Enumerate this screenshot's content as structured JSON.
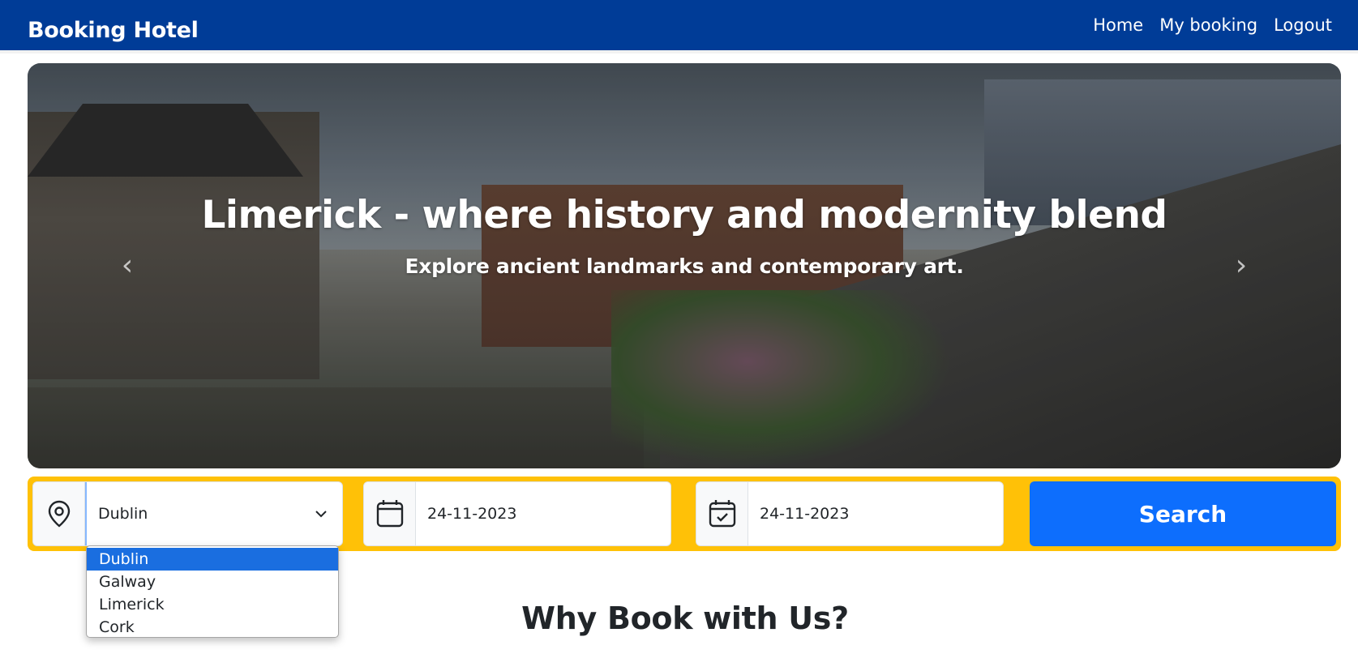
{
  "navbar": {
    "brand": "Booking Hotel",
    "links": [
      "Home",
      "My booking",
      "Logout"
    ]
  },
  "hero": {
    "title": "Limerick - where history and modernity blend",
    "subtitle": "Explore ancient landmarks and contemporary art.",
    "prev_icon": "chevron-left-icon",
    "next_icon": "chevron-right-icon"
  },
  "search": {
    "location_icon": "location-pin-icon",
    "location_value": "Dublin",
    "location_options": [
      "Dublin",
      "Galway",
      "Limerick",
      "Cork"
    ],
    "location_selected_index": 0,
    "checkin_icon": "calendar-icon",
    "checkin_value": "24-11-2023",
    "checkout_icon": "calendar-check-icon",
    "checkout_value": "24-11-2023",
    "button_label": "Search"
  },
  "section": {
    "title": "Why Book with Us?"
  },
  "colors": {
    "navbar": "#003c97",
    "search_bar": "#ffc107",
    "search_button": "#0d6efd",
    "dropdown_highlight": "#1a6ee0"
  }
}
